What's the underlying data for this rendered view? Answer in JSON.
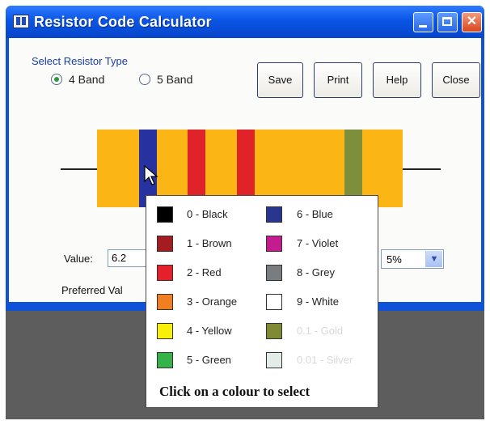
{
  "window": {
    "title": "Resistor Code Calculator",
    "controls": [
      "minimize",
      "maximize",
      "close"
    ]
  },
  "resistor_type": {
    "label": "Select Resistor Type",
    "options": [
      {
        "label": "4 Band",
        "selected": true
      },
      {
        "label": "5 Band",
        "selected": false
      }
    ]
  },
  "buttons": {
    "save": "Save",
    "print": "Print",
    "help": "Help",
    "close": "Close"
  },
  "bands": [
    {
      "color": "#2732a0"
    },
    {
      "color": "#e02329"
    },
    {
      "color": "#e02329"
    },
    {
      "color": "#7e8f3c"
    }
  ],
  "value": {
    "label": "Value:",
    "field": "6.2"
  },
  "tolerance": {
    "selected": "5%"
  },
  "preferred_label": "Preferred Val",
  "color_menu": {
    "left": [
      {
        "label": "0 - Black",
        "color": "#000000"
      },
      {
        "label": "1 - Brown",
        "color": "#a41b20"
      },
      {
        "label": "2 - Red",
        "color": "#e6202a"
      },
      {
        "label": "3 - Orange",
        "color": "#f07f22"
      },
      {
        "label": "4 - Yellow",
        "color": "#f9f009"
      },
      {
        "label": "5 - Green",
        "color": "#36b24a"
      }
    ],
    "right": [
      {
        "label": "6 - Blue",
        "color": "#283690"
      },
      {
        "label": "7 - Violet",
        "color": "#c21c8e"
      },
      {
        "label": "8 - Grey",
        "color": "#7a7d80"
      },
      {
        "label": "9 - White",
        "color": "#ffffff"
      },
      {
        "label": "0.1 - Gold",
        "color": "#808a35"
      },
      {
        "label": "0.01 - Silver",
        "color": "#e4ece8"
      }
    ],
    "hint": "Click on a colour to select"
  }
}
